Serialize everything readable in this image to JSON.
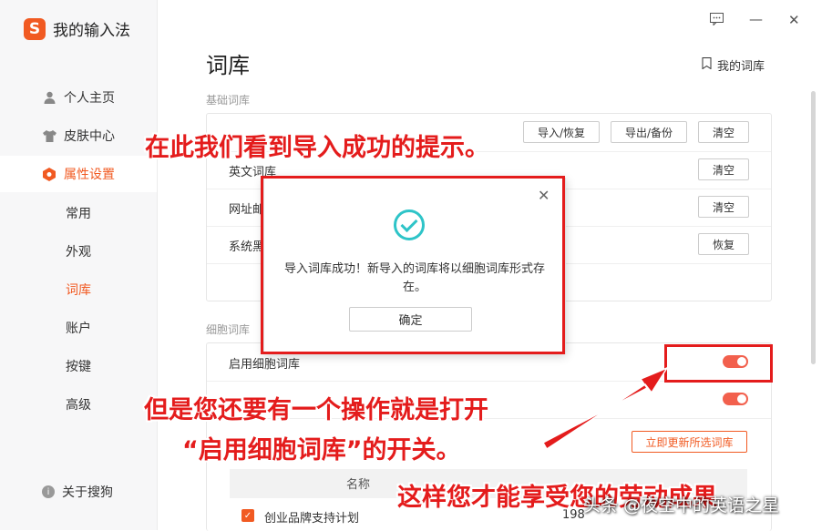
{
  "app": {
    "logo": "S",
    "title": "我的输入法"
  },
  "window": {
    "feedback_icon": "feedback-icon",
    "minimize": "—",
    "close": "✕"
  },
  "sidebar": {
    "items": [
      {
        "label": "个人主页",
        "icon": "person-icon"
      },
      {
        "label": "皮肤中心",
        "icon": "shirt-icon"
      },
      {
        "label": "属性设置",
        "icon": "hexagon-icon",
        "active": true
      }
    ],
    "sub_items": [
      {
        "label": "常用"
      },
      {
        "label": "外观"
      },
      {
        "label": "词库",
        "active": true
      },
      {
        "label": "账户"
      },
      {
        "label": "按键"
      },
      {
        "label": "高级"
      }
    ],
    "about": "关于搜狗"
  },
  "main": {
    "title": "词库",
    "my_dict": "我的词库",
    "basic_section": "基础词库",
    "basic_rows": [
      {
        "label": "",
        "buttons": [
          "导入/恢复",
          "导出/备份",
          "清空"
        ]
      },
      {
        "label": "英文词库",
        "buttons": [
          "清空"
        ]
      },
      {
        "label": "网址邮",
        "buttons": [
          "清空"
        ]
      },
      {
        "label": "系统黑",
        "buttons": [
          "恢复"
        ]
      }
    ],
    "cell_section": "细胞词库",
    "cell_rows": [
      {
        "label": "启用细胞词库",
        "toggle": true
      },
      {
        "label": "",
        "toggle": true
      }
    ],
    "update_button": "立即更新所选词库",
    "table": {
      "header_name": "名称",
      "rows": [
        {
          "name": "创业品牌支持计划",
          "count": "198"
        }
      ]
    }
  },
  "dialog": {
    "message": "导入词库成功！新导入的词库将以细胞词库形式存在。",
    "ok": "确定"
  },
  "annotations": {
    "top": "在此我们看到导入成功的提示。",
    "middle1": "但是您还要有一个操作就是打开",
    "middle2": "“启用细胞词库”的开关。",
    "bottom": "这样您才能享受您的劳动成果"
  },
  "watermark": "头条 @夜空中的英语之星",
  "colors": {
    "accent": "#f15a22",
    "annotation": "#e41c1c",
    "success": "#2ec4c8"
  }
}
